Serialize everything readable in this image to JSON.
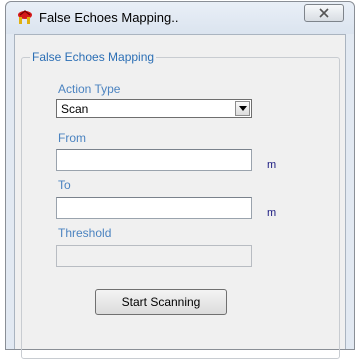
{
  "window": {
    "title": "False Echoes Mapping.."
  },
  "group": {
    "title": "False Echoes Mapping",
    "action_type": {
      "label": "Action Type",
      "value": "Scan"
    },
    "from": {
      "label": "From",
      "value": "",
      "unit": "m"
    },
    "to": {
      "label": "To",
      "value": "",
      "unit": "m"
    },
    "threshold": {
      "label": "Threshold",
      "value": ""
    },
    "start_button": "Start Scanning"
  },
  "icons": {
    "app": "app-icon",
    "close": "close-icon",
    "dropdown": "chevron-down-icon"
  },
  "colors": {
    "label": "#4b83c0",
    "group_title": "#2c6fb5",
    "unit": "#1a1a80"
  }
}
